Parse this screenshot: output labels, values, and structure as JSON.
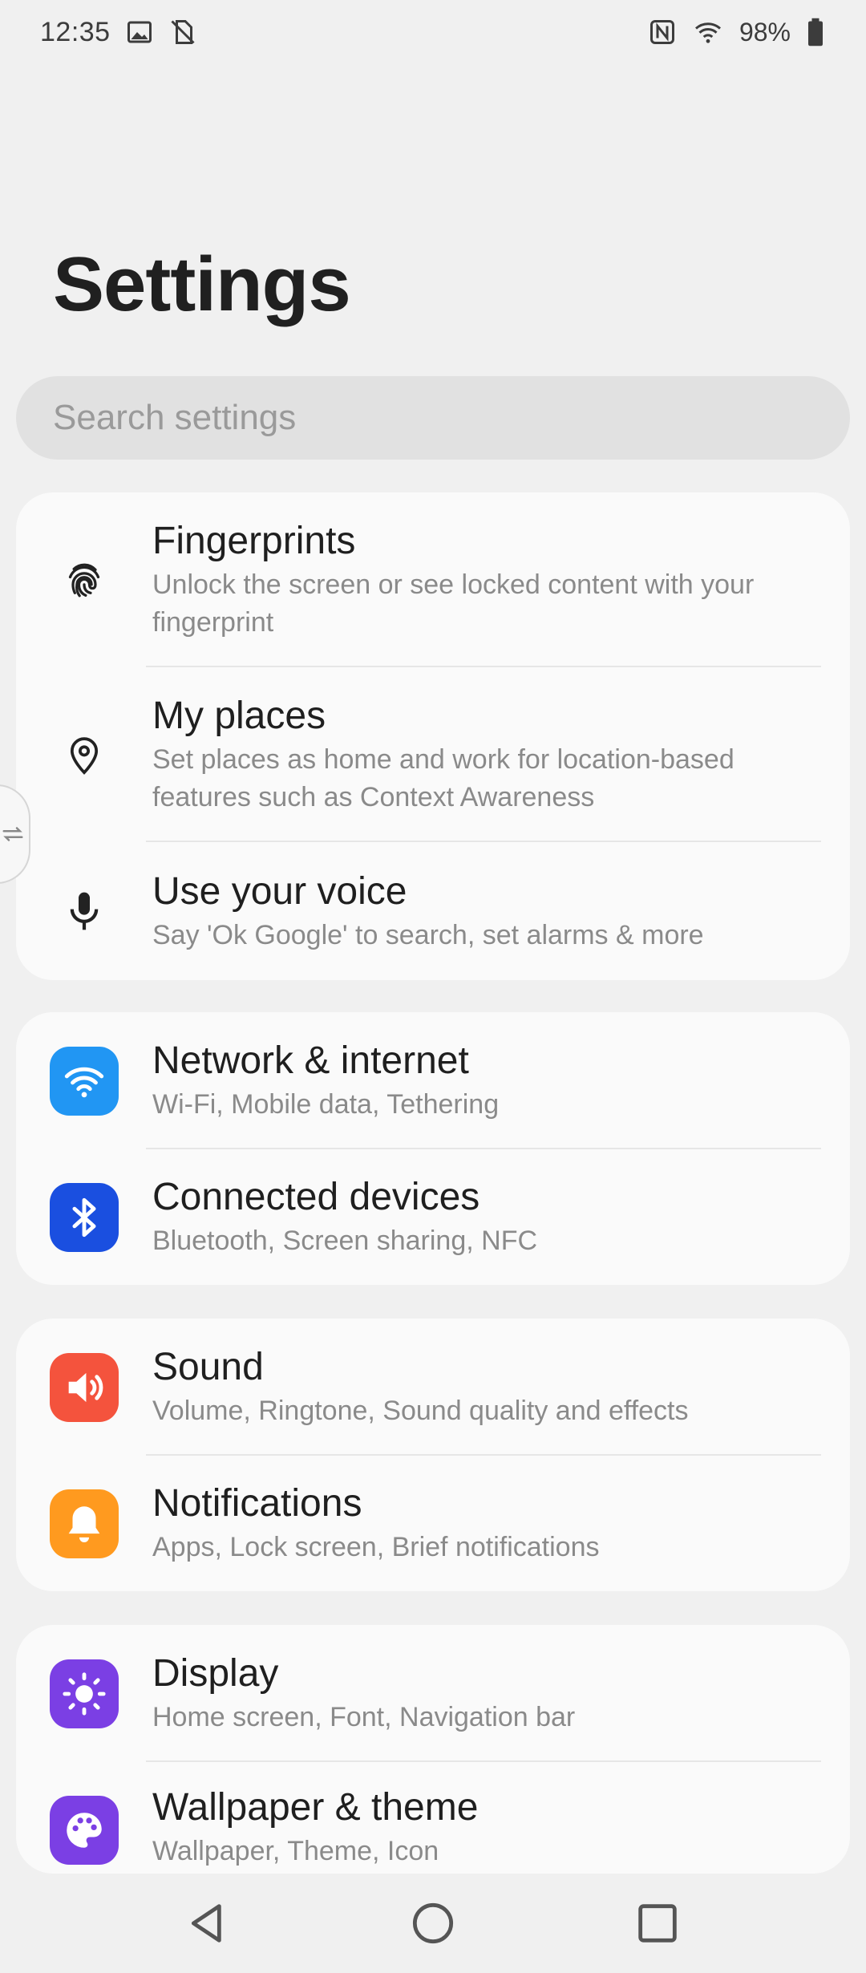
{
  "status_bar": {
    "time": "12:35",
    "battery_percent": "98%",
    "icons_left": [
      "gallery-icon",
      "sync-off-icon"
    ],
    "icons_right": [
      "nfc-icon",
      "wifi-icon",
      "battery-icon"
    ]
  },
  "page": {
    "title": "Settings"
  },
  "search": {
    "placeholder": "Search settings"
  },
  "groups": [
    {
      "items": [
        {
          "title": "Fingerprints",
          "subtitle": "Unlock the screen or see locked content with your fingerprint",
          "icon": "fingerprint-icon"
        },
        {
          "title": "My places",
          "subtitle": "Set places as home and work for location-based features such as Context Awareness",
          "icon": "location-pin-icon"
        },
        {
          "title": "Use your voice",
          "subtitle": "Say 'Ok Google' to search, set alarms & more",
          "icon": "microphone-icon"
        }
      ]
    },
    {
      "items": [
        {
          "title": "Network & internet",
          "subtitle": "Wi-Fi, Mobile data, Tethering",
          "icon": "wifi-icon",
          "color": "#2196f3"
        },
        {
          "title": "Connected devices",
          "subtitle": "Bluetooth, Screen sharing, NFC",
          "icon": "bluetooth-icon",
          "color": "#1a4fe0"
        }
      ]
    },
    {
      "items": [
        {
          "title": "Sound",
          "subtitle": "Volume, Ringtone, Sound quality and effects",
          "icon": "speaker-icon",
          "color": "#f4533d"
        },
        {
          "title": "Notifications",
          "subtitle": "Apps, Lock screen, Brief notifications",
          "icon": "bell-icon",
          "color": "#ff9a1f"
        }
      ]
    },
    {
      "items": [
        {
          "title": "Display",
          "subtitle": "Home screen, Font, Navigation bar",
          "icon": "brightness-icon",
          "color": "#7b3fe4"
        },
        {
          "title": "Wallpaper & theme",
          "subtitle": "Wallpaper, Theme, Icon",
          "icon": "palette-icon",
          "color": "#7b3fe4"
        }
      ]
    }
  ],
  "nav_bar": {
    "icons": [
      "back-icon",
      "home-icon",
      "recents-icon"
    ]
  }
}
